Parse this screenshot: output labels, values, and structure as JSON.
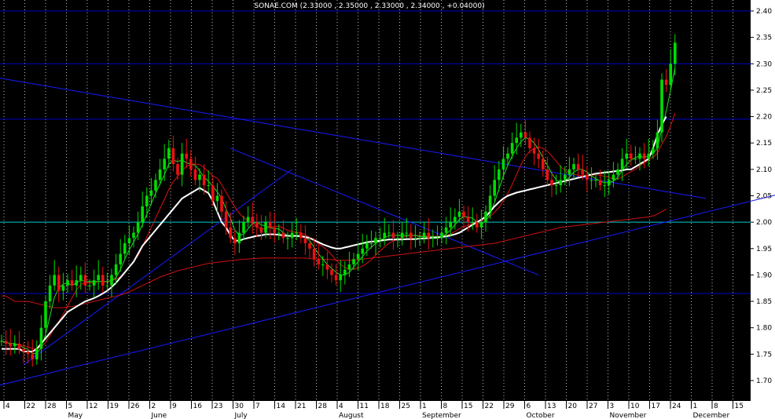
{
  "chart_data": {
    "type": "candlestick",
    "title": "SONAE.COM (2.33000 , 2.35000 , 2.33000 , 2.34000 , +0.04000)",
    "y_ticks": [
      "2.40",
      "2.35",
      "2.30",
      "2.25",
      "2.20",
      "2.15",
      "2.10",
      "2.05",
      "2.00",
      "1.95",
      "1.90",
      "1.85",
      "1.80",
      "1.75",
      "1.70"
    ],
    "ylim": [
      1.67,
      2.415
    ],
    "x_day_labels": [
      "4",
      "22",
      "28",
      "5",
      "12",
      "19",
      "26",
      "2",
      "9",
      "16",
      "23",
      "30",
      "7",
      "14",
      "21",
      "28",
      "4",
      "11",
      "18",
      "25",
      "1",
      "8",
      "15",
      "22",
      "29",
      "6",
      "13",
      "20",
      "27",
      "3",
      "10",
      "17",
      "24",
      "1",
      "8",
      "15"
    ],
    "x_month_labels": [
      "May",
      "June",
      "July",
      "August",
      "September",
      "October",
      "November",
      "December"
    ],
    "horizontal_lines": [
      {
        "y": 2.4,
        "color": "#0000cc"
      },
      {
        "y": 2.3,
        "color": "#0000cc"
      },
      {
        "y": 2.195,
        "color": "#0000cc"
      },
      {
        "y": 2.0,
        "color": "#00cccc"
      },
      {
        "y": 1.865,
        "color": "#0000cc"
      }
    ],
    "trend_lines": [
      {
        "from": {
          "day": -2,
          "price": 2.275
        },
        "to": {
          "day": 160,
          "price": 2.045
        },
        "color": "#1a1aff"
      },
      {
        "from": {
          "day": -2,
          "price": 1.688
        },
        "to": {
          "day": 208,
          "price": 2.117
        },
        "color": "#1a1aff"
      },
      {
        "from": {
          "day": 52,
          "price": 2.14
        },
        "to": {
          "day": 122,
          "price": 1.9
        },
        "color": "#1a1aff"
      },
      {
        "from": {
          "day": 5,
          "price": 1.73
        },
        "to": {
          "day": 66,
          "price": 2.1
        },
        "color": "#1a1aff"
      }
    ],
    "close_series": [
      1.775,
      1.77,
      1.765,
      1.77,
      1.76,
      1.755,
      1.75,
      1.74,
      1.76,
      1.8,
      1.85,
      1.88,
      1.9,
      1.87,
      1.88,
      1.89,
      1.88,
      1.89,
      1.9,
      1.88,
      1.88,
      1.89,
      1.9,
      1.88,
      1.88,
      1.9,
      1.92,
      1.94,
      1.96,
      1.97,
      1.98,
      2.0,
      2.03,
      2.05,
      2.06,
      2.08,
      2.1,
      2.12,
      2.14,
      2.11,
      2.09,
      2.13,
      2.12,
      2.1,
      2.08,
      2.09,
      2.07,
      2.07,
      2.04,
      2.05,
      2.02,
      1.99,
      1.97,
      1.96,
      1.98,
      2.0,
      2.01,
      2.0,
      1.99,
      1.98,
      2.0,
      1.99,
      1.98,
      1.98,
      1.97,
      1.97,
      1.98,
      1.98,
      1.97,
      1.96,
      1.95,
      1.93,
      1.92,
      1.92,
      1.91,
      1.9,
      1.89,
      1.9,
      1.91,
      1.92,
      1.93,
      1.94,
      1.95,
      1.96,
      1.96,
      1.97,
      1.97,
      1.98,
      1.98,
      1.97,
      1.97,
      1.98,
      1.98,
      1.97,
      1.97,
      1.97,
      1.98,
      1.97,
      1.97,
      1.97,
      1.98,
      1.99,
      2.0,
      2.01,
      2.02,
      2.01,
      2.0,
      2.0,
      1.99,
      2.0,
      2.02,
      2.05,
      2.08,
      2.1,
      2.12,
      2.13,
      2.15,
      2.16,
      2.17,
      2.16,
      2.14,
      2.13,
      2.12,
      2.1,
      2.08,
      2.07,
      2.07,
      2.08,
      2.09,
      2.1,
      2.11,
      2.1,
      2.09,
      2.08,
      2.08,
      2.08,
      2.07,
      2.07,
      2.08,
      2.09,
      2.1,
      2.12,
      2.13,
      2.12,
      2.12,
      2.13,
      2.12,
      2.13,
      2.14,
      2.17,
      2.27,
      2.26,
      2.3,
      2.34
    ],
    "ma_white": [
      1.76,
      1.76,
      1.76,
      1.76,
      1.76,
      1.755,
      1.755,
      1.755,
      1.76,
      1.77,
      1.78,
      1.79,
      1.8,
      1.81,
      1.82,
      1.83,
      1.835,
      1.84,
      1.845,
      1.85,
      1.853,
      1.856,
      1.86,
      1.865,
      1.87,
      1.877,
      1.885,
      1.895,
      1.905,
      1.915,
      1.925,
      1.94,
      1.955,
      1.965,
      1.975,
      1.985,
      1.995,
      2.005,
      2.015,
      2.025,
      2.035,
      2.045,
      2.05,
      2.055,
      2.06,
      2.065,
      2.06,
      2.055,
      2.04,
      2.02,
      2.0,
      1.99,
      1.975,
      1.965,
      1.965,
      1.968,
      1.97,
      1.972,
      1.974,
      1.975,
      1.977,
      1.977,
      1.977,
      1.976,
      1.975,
      1.974,
      1.974,
      1.974,
      1.973,
      1.972,
      1.97,
      1.966,
      1.962,
      1.958,
      1.955,
      1.952,
      1.95,
      1.95,
      1.952,
      1.954,
      1.956,
      1.958,
      1.96,
      1.962,
      1.963,
      1.964,
      1.965,
      1.966,
      1.967,
      1.967,
      1.967,
      1.967,
      1.968,
      1.968,
      1.968,
      1.969,
      1.969,
      1.97,
      1.97,
      1.971,
      1.972,
      1.973,
      1.975,
      1.977,
      1.98,
      1.985,
      1.99,
      1.995,
      2.0,
      2.005,
      2.01,
      2.02,
      2.03,
      2.038,
      2.045,
      2.05,
      2.053,
      2.056,
      2.058,
      2.06,
      2.062,
      2.064,
      2.066,
      2.068,
      2.07,
      2.072,
      2.074,
      2.076,
      2.078,
      2.08,
      2.082,
      2.084,
      2.086,
      2.088,
      2.09,
      2.092,
      2.093,
      2.094,
      2.095,
      2.096,
      2.097,
      2.098,
      2.1,
      2.1,
      2.105,
      2.11,
      2.115,
      2.12,
      2.14,
      2.165,
      2.185,
      2.2
    ],
    "ma_red_long": [
      1.86,
      1.86,
      1.855,
      1.85,
      1.85,
      1.85,
      1.85,
      1.848,
      1.846,
      1.844,
      1.842,
      1.84,
      1.838,
      1.838,
      1.838,
      1.84,
      1.84,
      1.842,
      1.844,
      1.846,
      1.848,
      1.85,
      1.852,
      1.854,
      1.856,
      1.858,
      1.86,
      1.862,
      1.865,
      1.868,
      1.872,
      1.876,
      1.88,
      1.884,
      1.888,
      1.892,
      1.896,
      1.899,
      1.902,
      1.905,
      1.908,
      1.91,
      1.912,
      1.914,
      1.916,
      1.918,
      1.92,
      1.922,
      1.923,
      1.924,
      1.925,
      1.926,
      1.927,
      1.928,
      1.929,
      1.93,
      1.93,
      1.931,
      1.931,
      1.932,
      1.932,
      1.932,
      1.932,
      1.932,
      1.932,
      1.932,
      1.932,
      1.932,
      1.932,
      1.932,
      1.931,
      1.93,
      1.93,
      1.93,
      1.929,
      1.929,
      1.928,
      1.928,
      1.928,
      1.928,
      1.928,
      1.929,
      1.93,
      1.931,
      1.932,
      1.933,
      1.934,
      1.935,
      1.936,
      1.937,
      1.938,
      1.939,
      1.94,
      1.941,
      1.942,
      1.943,
      1.944,
      1.945,
      1.946,
      1.947,
      1.948,
      1.949,
      1.95,
      1.951,
      1.952,
      1.953,
      1.954,
      1.955,
      1.956,
      1.957,
      1.958,
      1.959,
      1.96,
      1.962,
      1.964,
      1.966,
      1.968,
      1.97,
      1.972,
      1.974,
      1.976,
      1.978,
      1.98,
      1.982,
      1.984,
      1.986,
      1.988,
      1.99,
      1.991,
      1.992,
      1.993,
      1.994,
      1.995,
      1.996,
      1.997,
      1.998,
      1.999,
      2.0,
      2.001,
      2.002,
      2.003,
      2.004,
      2.005,
      2.006,
      2.007,
      2.008,
      2.009,
      2.01,
      2.012,
      2.015,
      2.02,
      2.025
    ]
  }
}
